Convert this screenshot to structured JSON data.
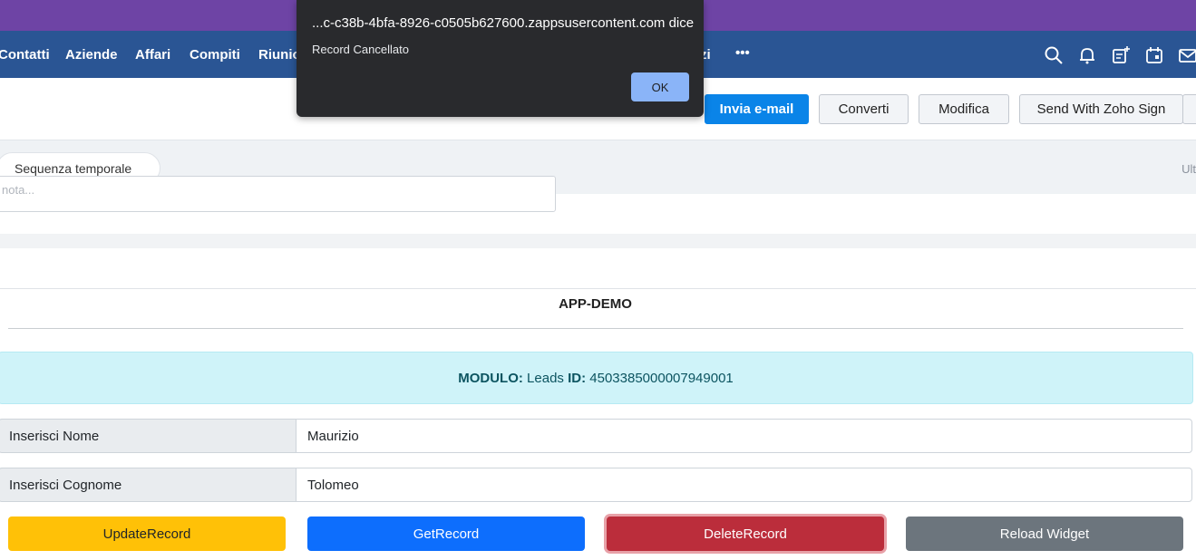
{
  "nav": {
    "items": [
      "Contatti",
      "Aziende",
      "Affari",
      "Compiti",
      "Riunio",
      "zi"
    ],
    "more": "•••",
    "icons": [
      "search-icon",
      "bell-icon",
      "add-note-icon",
      "calendar-icon",
      "mail-icon"
    ]
  },
  "actions": {
    "send_email": "Invia e-mail",
    "convert": "Converti",
    "edit": "Modifica",
    "zoho_sign": "Send With Zoho Sign"
  },
  "timeline": {
    "pill": "Sequenza temporale",
    "right_text": "Ult"
  },
  "note": {
    "placeholder": "nota..."
  },
  "widget": {
    "title": "APP-DEMO",
    "module_label": "MODULO:",
    "module_value": "Leads",
    "id_label": "ID:",
    "id_value": "4503385000007949001",
    "fields": [
      {
        "label": "Inserisci Nome",
        "value": "Maurizio"
      },
      {
        "label": "Inserisci Cognome",
        "value": "Tolomeo"
      }
    ],
    "buttons": {
      "update": "UpdateRecord",
      "get": "GetRecord",
      "delete": "DeleteRecord",
      "reload": "Reload Widget"
    }
  },
  "dialog": {
    "title": "...c-c38b-4bfa-8926-c0505b627600.zappsusercontent.com dice",
    "message": "Record Cancellato",
    "ok": "OK"
  },
  "colors": {
    "topbar": "#6e44a5",
    "navbar": "#2a5594",
    "primary": "#0a84e8",
    "update": "#ffc107",
    "get": "#0d6efd",
    "delete": "#bb2d3b",
    "reload": "#6c757d"
  }
}
